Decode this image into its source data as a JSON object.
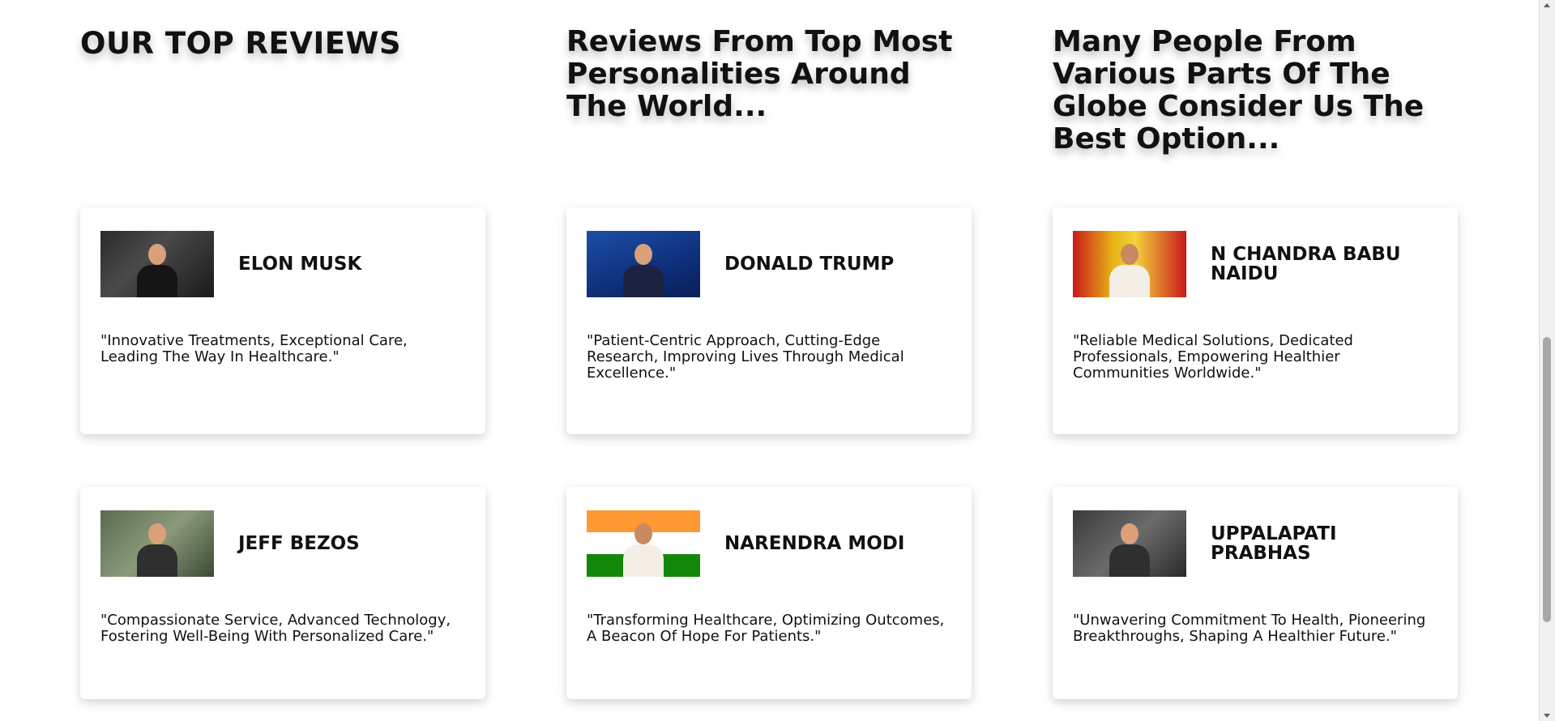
{
  "headings": {
    "main": "OUR TOP REVIEWS",
    "personalities": "Reviews From Top Most Personalities Around The World...",
    "globe": "Many People From Various Parts Of The Globe Consider Us The Best Option..."
  },
  "reviews": [
    {
      "name": "ELON MUSK",
      "quote": "\"Innovative Treatments, Exceptional Care, Leading The Way In Healthcare.\""
    },
    {
      "name": "DONALD TRUMP",
      "quote": "\"Patient-Centric Approach, Cutting-Edge Research, Improving Lives Through Medical Excellence.\""
    },
    {
      "name": "N CHANDRA BABU NAIDU",
      "quote": "\"Reliable Medical Solutions, Dedicated Professionals, Empowering Healthier Communities Worldwide.\""
    },
    {
      "name": "JEFF BEZOS",
      "quote": "\"Compassionate Service, Advanced Technology, Fostering Well-Being With Personalized Care.\""
    },
    {
      "name": "NARENDRA MODI",
      "quote": "\"Transforming Healthcare, Optimizing Outcomes, A Beacon Of Hope For Patients.\""
    },
    {
      "name": "UPPALAPATI PRABHAS",
      "quote": "\"Unwavering Commitment To Health, Pioneering Breakthroughs, Shaping A Healthier Future.\""
    }
  ]
}
